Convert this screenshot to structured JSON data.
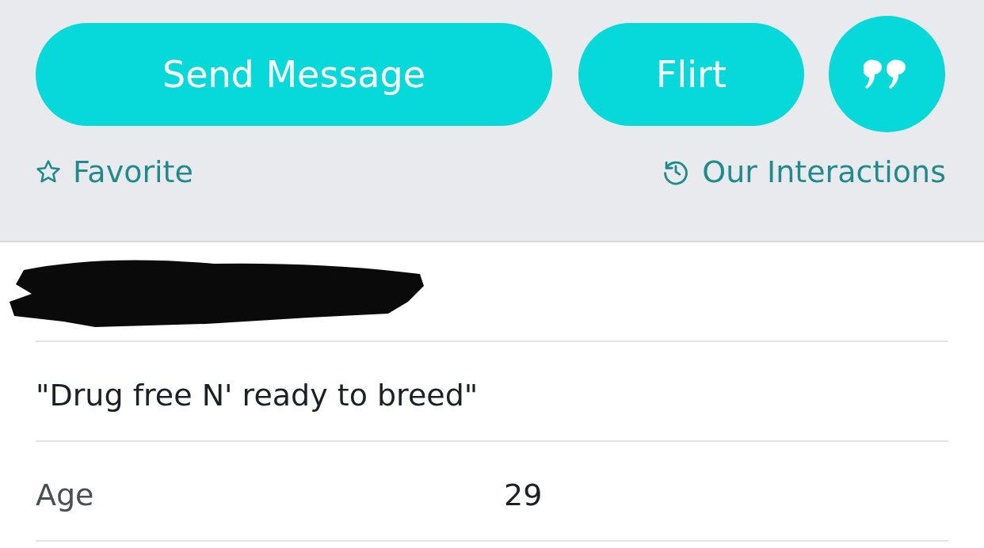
{
  "actions": [
    {
      "kind": "wide",
      "label": "Send Message"
    },
    {
      "kind": "medium",
      "label": "Flirt"
    },
    {
      "kind": "quote"
    }
  ],
  "links": [
    {
      "kind": "favorite",
      "label": "Favorite"
    },
    {
      "kind": "history",
      "label": "Our Interactions"
    }
  ],
  "tagline": "\"Drug free N' ready to breed\"",
  "details": [
    {
      "label": "Age",
      "value": "29"
    }
  ]
}
